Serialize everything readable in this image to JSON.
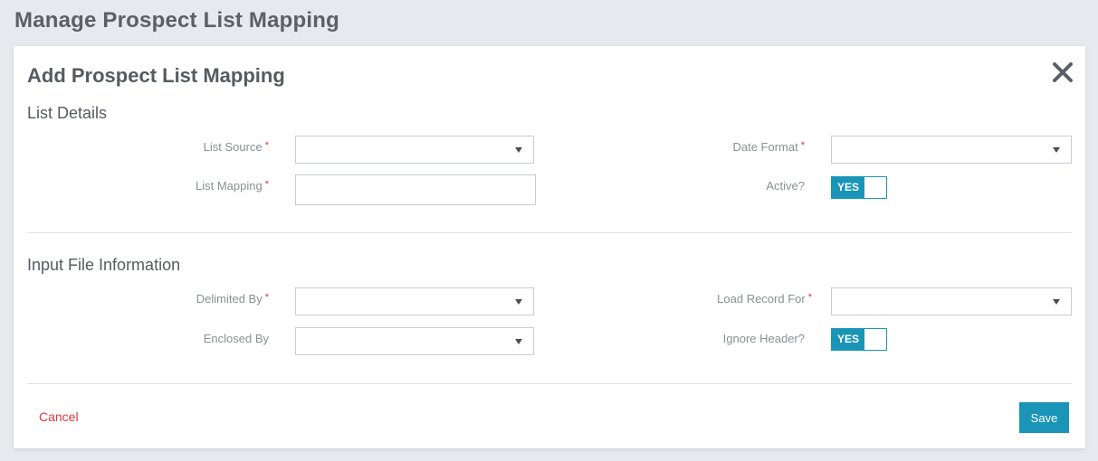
{
  "page": {
    "title": "Manage Prospect List Mapping"
  },
  "modal": {
    "title": "Add Prospect List Mapping",
    "close_icon": "close-icon"
  },
  "list_details": {
    "title": "List Details",
    "list_source": {
      "label": "List Source",
      "required_mark": "*",
      "value": ""
    },
    "list_mapping": {
      "label": "List Mapping",
      "required_mark": "*",
      "value": ""
    },
    "date_format": {
      "label": "Date Format",
      "required_mark": "*",
      "value": ""
    },
    "active": {
      "label": "Active?",
      "toggle_text": "YES"
    }
  },
  "input_file_information": {
    "title": "Input File Information",
    "delimited_by": {
      "label": "Delimited By",
      "required_mark": "*",
      "value": ""
    },
    "enclosed_by": {
      "label": "Enclosed By",
      "value": ""
    },
    "load_record_for": {
      "label": "Load Record For",
      "required_mark": "*",
      "value": ""
    },
    "ignore_header": {
      "label": "Ignore Header?",
      "toggle_text": "YES"
    }
  },
  "footer": {
    "cancel_label": "Cancel",
    "save_label": "Save"
  },
  "colors": {
    "accent": "#1a95b8",
    "required": "#d9363e",
    "background": "#e6e9ee"
  }
}
